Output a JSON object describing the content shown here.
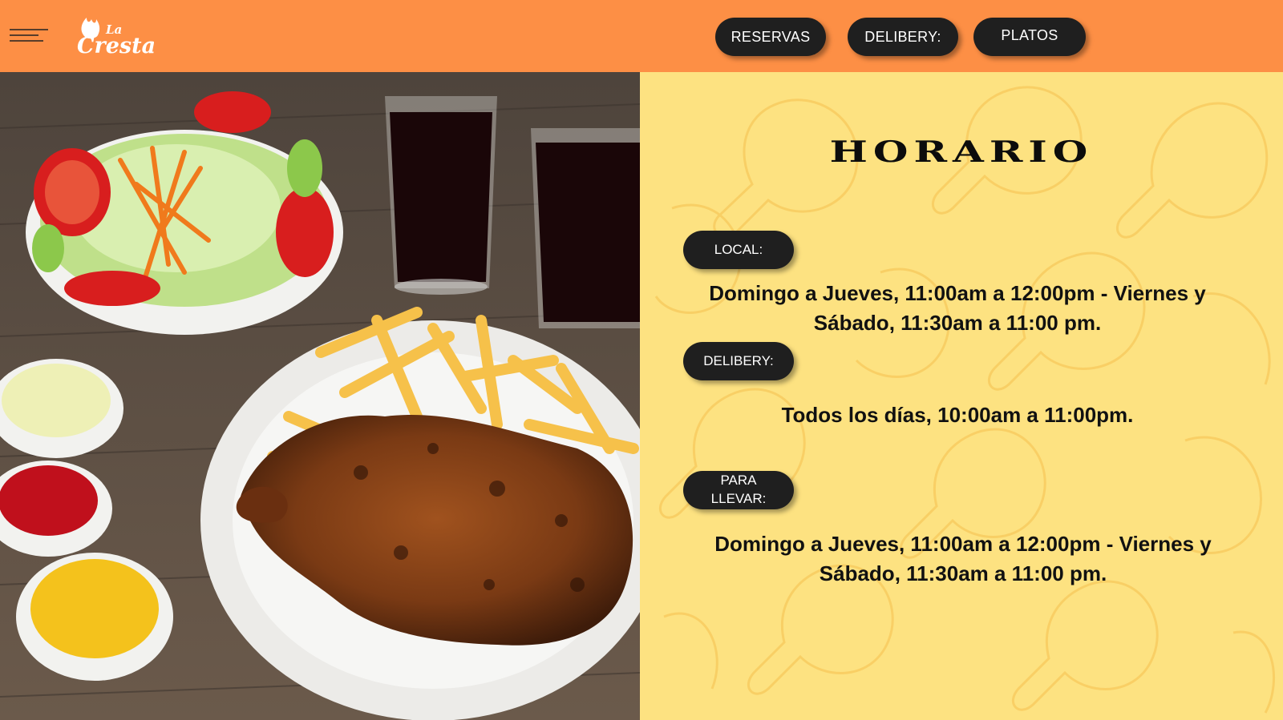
{
  "header": {
    "logo_text": "La Cresta",
    "nav": [
      {
        "label": "RESERVAS"
      },
      {
        "label": "DELIBERY:"
      },
      {
        "label": "PLATOS"
      }
    ]
  },
  "schedule": {
    "title": "HORARIO",
    "sections": [
      {
        "label": "LOCAL:",
        "hours": "Domingo a Jueves, 11:00am a 12:00pm - Viernes y Sábado, 11:30am a 11:00 pm."
      },
      {
        "label": "DELIBERY:",
        "hours": "Todos los días, 10:00am a 11:00pm."
      },
      {
        "label": "PARA LLEVAR:",
        "hours": "Domingo a Jueves, 11:00am a 12:00pm - Viernes y Sábado, 11:30am a 11:00 pm."
      }
    ]
  },
  "colors": {
    "header_bg": "#fd8f45",
    "panel_bg": "#fde281",
    "button_bg": "#1f1f1f"
  },
  "icons": [
    "menu-icon",
    "flame-logo-icon"
  ]
}
